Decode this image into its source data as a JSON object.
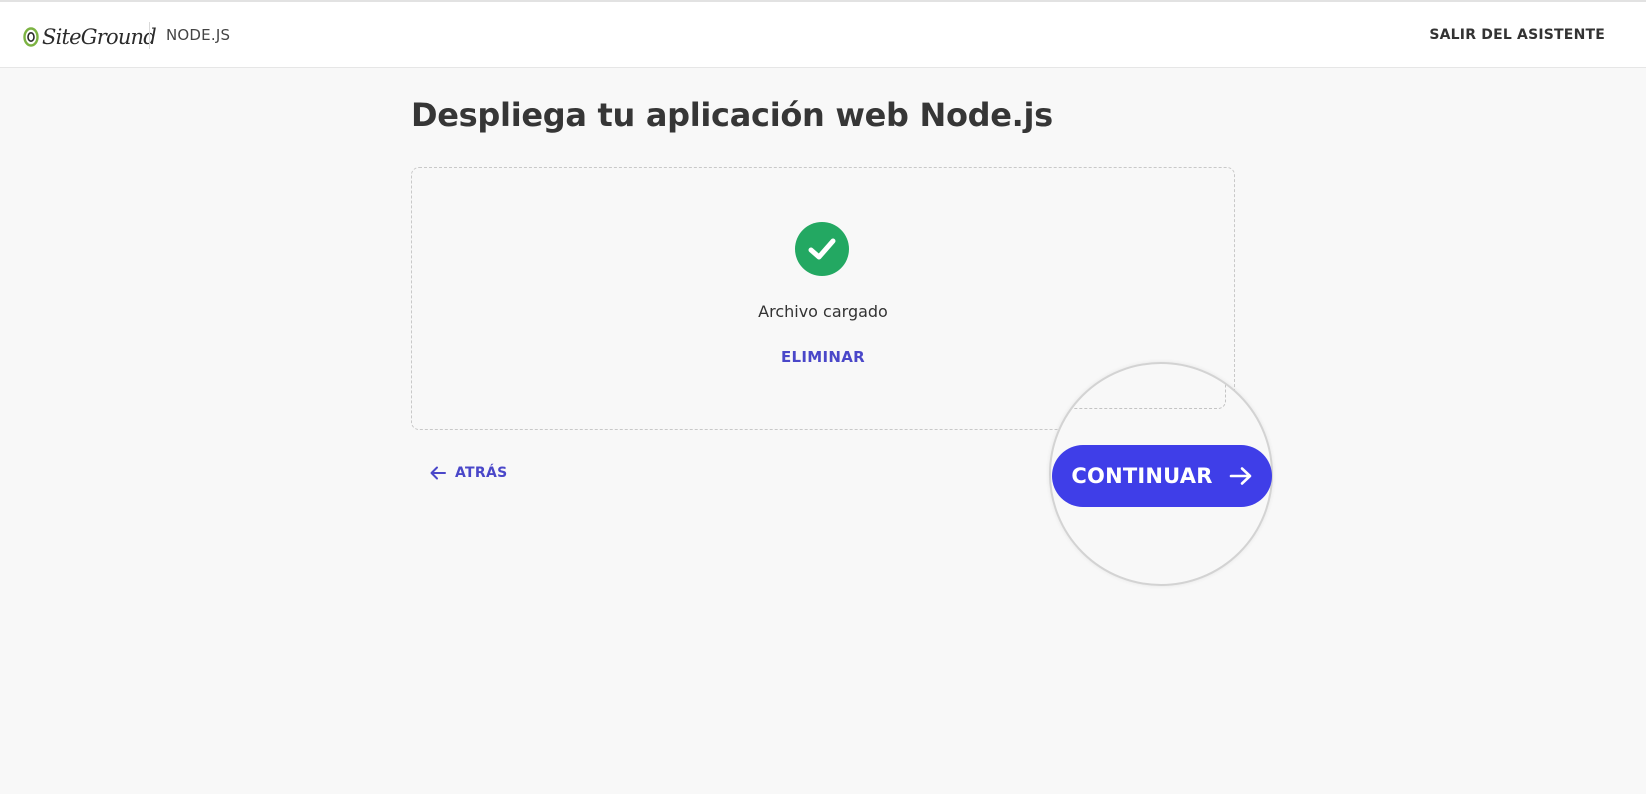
{
  "header": {
    "brand": "SiteGround",
    "app_label": "NODE.JS",
    "exit_label": "SALIR DEL ASISTENTE"
  },
  "page": {
    "title": "Despliega tu aplicación web Node.js"
  },
  "upload": {
    "status_text": "Archivo cargado",
    "remove_label": "ELIMINAR",
    "icon": "check-circle-icon"
  },
  "navigation": {
    "back_label": "ATRÁS",
    "continue_label": "CONTINUAR"
  },
  "colors": {
    "accent": "#3f3ee8",
    "link": "#4a47c9",
    "success": "#23a862",
    "brand_green": "#7cb342"
  }
}
